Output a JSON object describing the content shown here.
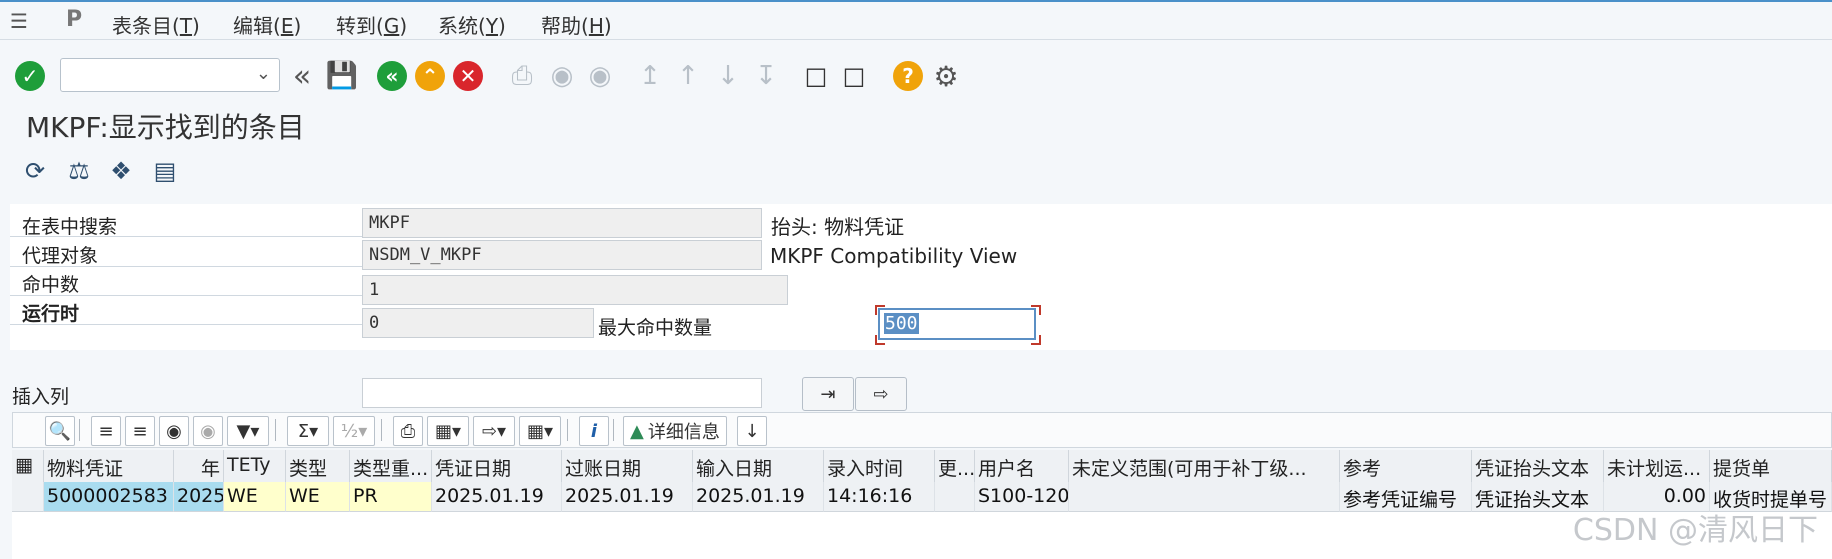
{
  "menu": {
    "items": [
      {
        "label": "表条目(",
        "key": "T",
        "end": ")"
      },
      {
        "label": "编辑(",
        "key": "E",
        "end": ")"
      },
      {
        "label": "转到(",
        "key": "G",
        "end": ")"
      },
      {
        "label": "系统(",
        "key": "Y",
        "end": ")"
      },
      {
        "label": "帮助(",
        "key": "H",
        "end": ")"
      }
    ]
  },
  "toolbar": {
    "command_value": ""
  },
  "title": "MKPF:显示找到的条目",
  "form": {
    "search_label": "在表中搜索",
    "search_value": "MKPF",
    "search_desc": "抬头: 物料凭证",
    "proxy_label": "代理对象",
    "proxy_value": "NSDM_V_MKPF",
    "proxy_desc": "MKPF Compatibility View",
    "hits_label": "命中数",
    "hits_value": "1",
    "runtime_label": "运行时",
    "runtime_value": "0",
    "maxhits_label": "最大命中数量",
    "maxhits_value": "500",
    "insert_label": "插入列"
  },
  "alv": {
    "details_label": "详细信息"
  },
  "grid": {
    "headers": [
      "物料凭证",
      "年",
      "TETy",
      "类型",
      "类型重...",
      "凭证日期",
      "过账日期",
      "输入日期",
      "录入时间",
      "更...",
      "用户名",
      "未定义范围(可用于补丁级...",
      "参考",
      "凭证抬头文本",
      "未计划运...",
      "提货单"
    ],
    "row": [
      "5000002583",
      "2025",
      "WE",
      "WE",
      "PR",
      "2025.01.19",
      "2025.01.19",
      "2025.01.19",
      "14:16:16",
      "",
      "S100-120",
      "",
      "参考凭证编号",
      "凭证抬头文本",
      "0.00",
      "收货时提单号"
    ]
  },
  "watermark": "CSDN @清风日下"
}
